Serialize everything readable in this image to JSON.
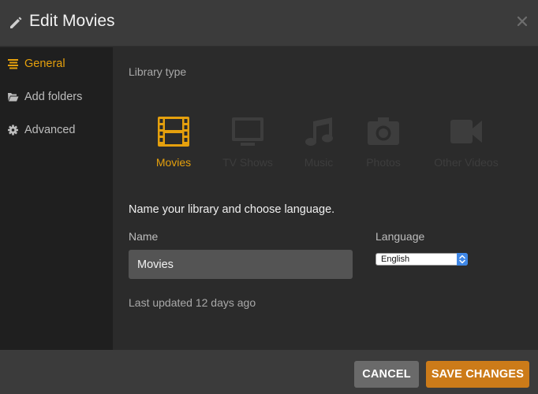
{
  "header": {
    "title": "Edit Movies"
  },
  "sidebar": {
    "items": [
      {
        "label": "General",
        "icon": "list-lines-icon",
        "active": true
      },
      {
        "label": "Add folders",
        "icon": "folder-open-icon",
        "active": false
      },
      {
        "label": "Advanced",
        "icon": "gear-icon",
        "active": false
      }
    ]
  },
  "main": {
    "section_title": "Library type",
    "library_types": [
      {
        "label": "Movies",
        "icon": "film-icon",
        "selected": true
      },
      {
        "label": "TV Shows",
        "icon": "tv-icon",
        "selected": false
      },
      {
        "label": "Music",
        "icon": "music-note-icon",
        "selected": false
      },
      {
        "label": "Photos",
        "icon": "camera-icon",
        "selected": false
      },
      {
        "label": "Other Videos",
        "icon": "video-camera-icon",
        "selected": false
      }
    ],
    "prompt": "Name your library and choose language.",
    "name_label": "Name",
    "name_value": "Movies",
    "language_label": "Language",
    "language_value": "English",
    "last_updated": "Last updated 12 days ago"
  },
  "footer": {
    "cancel_label": "CANCEL",
    "save_label": "SAVE CHANGES"
  },
  "colors": {
    "accent": "#e5a00d",
    "save_button": "#cc7b19",
    "cancel_button": "#6a6a6a",
    "header_bg": "#3b3b3b",
    "sidebar_bg": "#1f1f1f",
    "main_bg": "#2b2b2b"
  }
}
